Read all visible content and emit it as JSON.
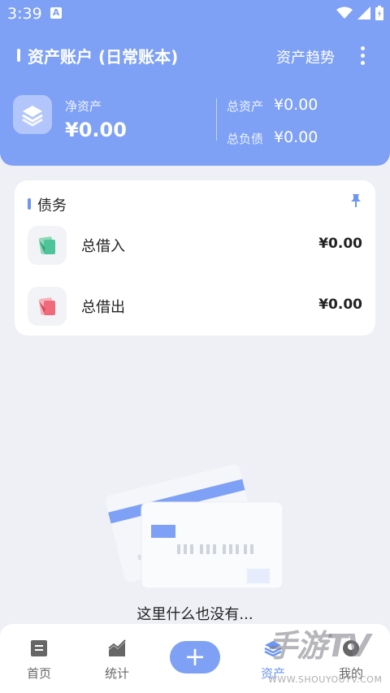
{
  "status_bar": {
    "time": "3:39",
    "notif_icon": "A"
  },
  "header": {
    "title": "资产账户 (日常账本)",
    "trend_label": "资产趋势",
    "net_assets_label": "净资产",
    "net_assets_value": "¥0.00",
    "total_assets_label": "总资产",
    "total_assets_value": "¥0.00",
    "total_debt_label": "总负债",
    "total_debt_value": "¥0.00",
    "bg_color": "#7ea1f5"
  },
  "debt_card": {
    "title": "债务",
    "rows": [
      {
        "label": "总借入",
        "value": "¥0.00",
        "icon": "borrow-in-icon"
      },
      {
        "label": "总借出",
        "value": "¥0.00",
        "icon": "lend-out-icon"
      }
    ]
  },
  "empty_state": {
    "text": "这里什么也没有..."
  },
  "nav": {
    "items": [
      {
        "label": "首页",
        "icon": "home-icon"
      },
      {
        "label": "统计",
        "icon": "stats-icon"
      },
      {
        "label": "资产",
        "icon": "assets-icon",
        "active": true
      },
      {
        "label": "我的",
        "icon": "profile-icon"
      }
    ],
    "add_label": "+"
  },
  "watermark": {
    "main": "手游TV",
    "sub": "WWW.SHOUYOUTV.COM"
  },
  "colors": {
    "accent": "#6d95f3",
    "green": "#4fc49a",
    "red": "#ef6b7b"
  }
}
